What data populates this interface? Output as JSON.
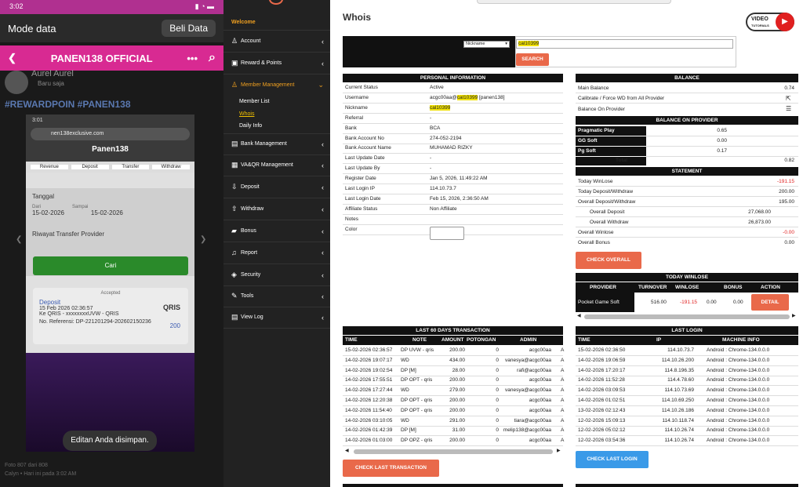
{
  "phone": {
    "time": "3:02",
    "top_left": "Mode data",
    "top_right": "Beli Data",
    "bar_title": "PANEN138 OFFICIAL",
    "user": "Aurel Aurel",
    "user_sub": "Baru saja",
    "tags": "#REWARDPOIN #PANEN138",
    "inner_url": "nen138exclusive.com",
    "brand": "Panen138",
    "tabs": [
      "Revenue",
      "Deposit",
      "Transfer",
      "Withdraw"
    ],
    "tanggal": "Tanggal",
    "dari_label": "Dari",
    "dari": "15-02-2026",
    "sampai_label": "Sampai",
    "sampai": "15-02-2026",
    "riwayat": "Riwayat Transfer Provider",
    "cari": "Cari",
    "accepted": "Accepted",
    "dep_title": "Deposit",
    "dep_date": "15 Feb 2026 02:36:57",
    "dep_ke": "Ke QRIS - xxxxxxxxUVW - QRIS",
    "dep_amount": "200",
    "dep_ref": "No. Referensi: DP-221201294-202602150236",
    "qris": "QRIS",
    "toast": "Editan Anda disimpan.",
    "foot1": "Foto 807 dari 808",
    "foot2": "Calyn • Hari ini pada 3:02 AM"
  },
  "sidebar": {
    "welcome": "Welcome",
    "items": [
      {
        "label": "Account",
        "icon": "user-icon"
      },
      {
        "label": "Reward & Points",
        "icon": "gift-icon"
      },
      {
        "label": "Member Management",
        "icon": "users-icon"
      },
      {
        "label": "Bank Management",
        "icon": "bank-icon"
      },
      {
        "label": "VA&QR Management",
        "icon": "qr-icon"
      },
      {
        "label": "Deposit",
        "icon": "deposit-icon"
      },
      {
        "label": "Withdraw",
        "icon": "withdraw-icon"
      },
      {
        "label": "Bonus",
        "icon": "bonus-icon"
      },
      {
        "label": "Report",
        "icon": "bell-icon"
      },
      {
        "label": "Security",
        "icon": "shield-icon"
      },
      {
        "label": "Tools",
        "icon": "wrench-icon"
      },
      {
        "label": "View Log",
        "icon": "log-icon"
      }
    ],
    "sub": [
      "Member List",
      "Whois",
      "Daily Info"
    ]
  },
  "main": {
    "title": "Whois",
    "video": "VIDEO",
    "video_sub": "TUTORIALS",
    "search_select": "Nickname",
    "search_value": "cal10399",
    "search_btn": "SEARCH",
    "personal": {
      "header": "PERSONAL INFORMATION",
      "rows": [
        [
          "Current Status",
          "Active"
        ],
        [
          "Username",
          "acgc00aa@cal10399 [panen138]"
        ],
        [
          "Nickname",
          "cal10399"
        ],
        [
          "Referral",
          "-"
        ],
        [
          "Bank",
          "BCA"
        ],
        [
          "Bank Account No",
          "274-052-2194"
        ],
        [
          "Bank Account Name",
          "MUHAMAD RIZKY"
        ],
        [
          "Last Update Date",
          "-"
        ],
        [
          "Last Update By",
          "-"
        ],
        [
          "Register Date",
          "Jan 5, 2026, 11:49:22 AM"
        ],
        [
          "Last Login IP",
          "114.10.73.7"
        ],
        [
          "Last Login Date",
          "Feb 15, 2026, 2:36:50 AM"
        ],
        [
          "Affiliate Status",
          "Non Affiliate"
        ],
        [
          "Notes",
          ""
        ],
        [
          "Color",
          ""
        ]
      ],
      "user_pre": "acgc00aa@",
      "user_hl": "cal10399",
      "user_post": " [panen138]"
    },
    "balance": {
      "header": "BALANCE",
      "main_label": "Main Balance",
      "main_value": "0.74",
      "calibrate": "Calibrate / Force WD from All Provider",
      "on_provider": "Balance On Provider",
      "bop_header": "BALANCE ON PROVIDER",
      "providers": [
        [
          "Pragmatic Play",
          "0.65"
        ],
        [
          "GG Soft",
          "0.00"
        ],
        [
          "Pg Soft",
          "0.17"
        ]
      ],
      "total_label": "Total",
      "total_value": "0.82"
    },
    "statement": {
      "header": "STATEMENT",
      "rows": [
        [
          "Today WinLose",
          "-191.15",
          "red"
        ],
        [
          "Today Deposit/Withdraw",
          "200.00",
          ""
        ],
        [
          "Overall Deposit/Withdraw",
          "195.00",
          ""
        ]
      ],
      "overall_dep_label": "Overall Deposit",
      "overall_dep": "27,068.00",
      "overall_wd_label": "Overall Withdraw",
      "overall_wd": "26,873.00",
      "winlose_label": "Overall Winlose",
      "winlose": "-0.00",
      "bonus_label": "Overall Bonus",
      "bonus": "0.00",
      "btn": "CHECK OVERALL"
    },
    "today": {
      "header": "TODAY WINLOSE",
      "cols": [
        "PROVIDER",
        "TURNOVER",
        "WINLOSE",
        "BONUS",
        "ACTION"
      ],
      "provider": "Pocket Game Soft",
      "turnover": "516.00",
      "winlose": "-191.15",
      "bonus": "0.00",
      "bonus2": "0.00",
      "btn": "DETAIL"
    },
    "tx": {
      "header": "LAST 60 DAYS TRANSACTION",
      "cols": [
        "TIME",
        "NOTE",
        "AMOUNT",
        "POTONGAN",
        "ADMIN"
      ],
      "rows": [
        [
          "15-02-2026 02:36:57",
          "DP UVW - qris",
          "200.00",
          "0",
          "acgc00aa",
          "A"
        ],
        [
          "14-02-2026 19:07:17",
          "WD",
          "434.00",
          "0",
          "vanesya@acgc00aa",
          "A"
        ],
        [
          "14-02-2026 19:02:54",
          "DP [M]",
          "28.00",
          "0",
          "rafi@acgc00aa",
          "A"
        ],
        [
          "14-02-2026 17:55:51",
          "DP OPT - qris",
          "200.00",
          "0",
          "acgc00aa",
          "A"
        ],
        [
          "14-02-2026 17:27:44",
          "WD",
          "279.00",
          "0",
          "vanesya@acgc00aa",
          "A"
        ],
        [
          "14-02-2026 12:20:38",
          "DP OPT - qris",
          "200.00",
          "0",
          "acgc00aa",
          "A"
        ],
        [
          "14-02-2026 11:54:40",
          "DP OPT - qris",
          "200.00",
          "0",
          "acgc00aa",
          "A"
        ],
        [
          "14-02-2026 03:10:05",
          "WD",
          "291.00",
          "0",
          "tiara@acgc00aa",
          "A"
        ],
        [
          "14-02-2026 01:42:39",
          "DP [M]",
          "31.00",
          "0",
          "melip138@acgc00aa",
          "A"
        ],
        [
          "14-02-2026 01:03:00",
          "DP OPZ - qris",
          "200.00",
          "0",
          "acgc00aa",
          "A"
        ]
      ],
      "btn": "CHECK LAST TRANSACTION"
    },
    "login": {
      "header": "LAST LOGIN",
      "cols": [
        "TIME",
        "IP",
        "MACHINE INFO"
      ],
      "rows": [
        [
          "15-02-2026 02:36:50",
          "114.10.73.7",
          "Android : Chrome-134.0.0.0"
        ],
        [
          "14-02-2026 19:06:59",
          "114.10.26.200",
          "Android : Chrome-134.0.0.0"
        ],
        [
          "14-02-2026 17:20:17",
          "114.8.196.35",
          "Android : Chrome-134.0.0.0"
        ],
        [
          "14-02-2026 11:52:28",
          "114.4.78.60",
          "Android : Chrome-134.0.0.0"
        ],
        [
          "14-02-2026 03:09:53",
          "114.10.73.69",
          "Android : Chrome-134.0.0.0"
        ],
        [
          "14-02-2026 01:02:51",
          "114.10.69.250",
          "Android : Chrome-134.0.0.0"
        ],
        [
          "13-02-2026 02:12:43",
          "114.10.26.186",
          "Android : Chrome-134.0.0.0"
        ],
        [
          "12-02-2026 15:09:13",
          "114.10.118.74",
          "Android : Chrome-134.0.0.0"
        ],
        [
          "12-02-2026 05:02:12",
          "114.10.26.74",
          "Android : Chrome-134.0.0.0"
        ],
        [
          "12-02-2026 03:54:36",
          "114.10.26.74",
          "Android : Chrome-134.0.0.0"
        ]
      ],
      "btn": "CHECK LAST LOGIN"
    }
  },
  "colors": {
    "accent": "#e9694a",
    "blue": "#3a9ae8",
    "pink": "#d82a92",
    "highlight": "#f0e000"
  }
}
